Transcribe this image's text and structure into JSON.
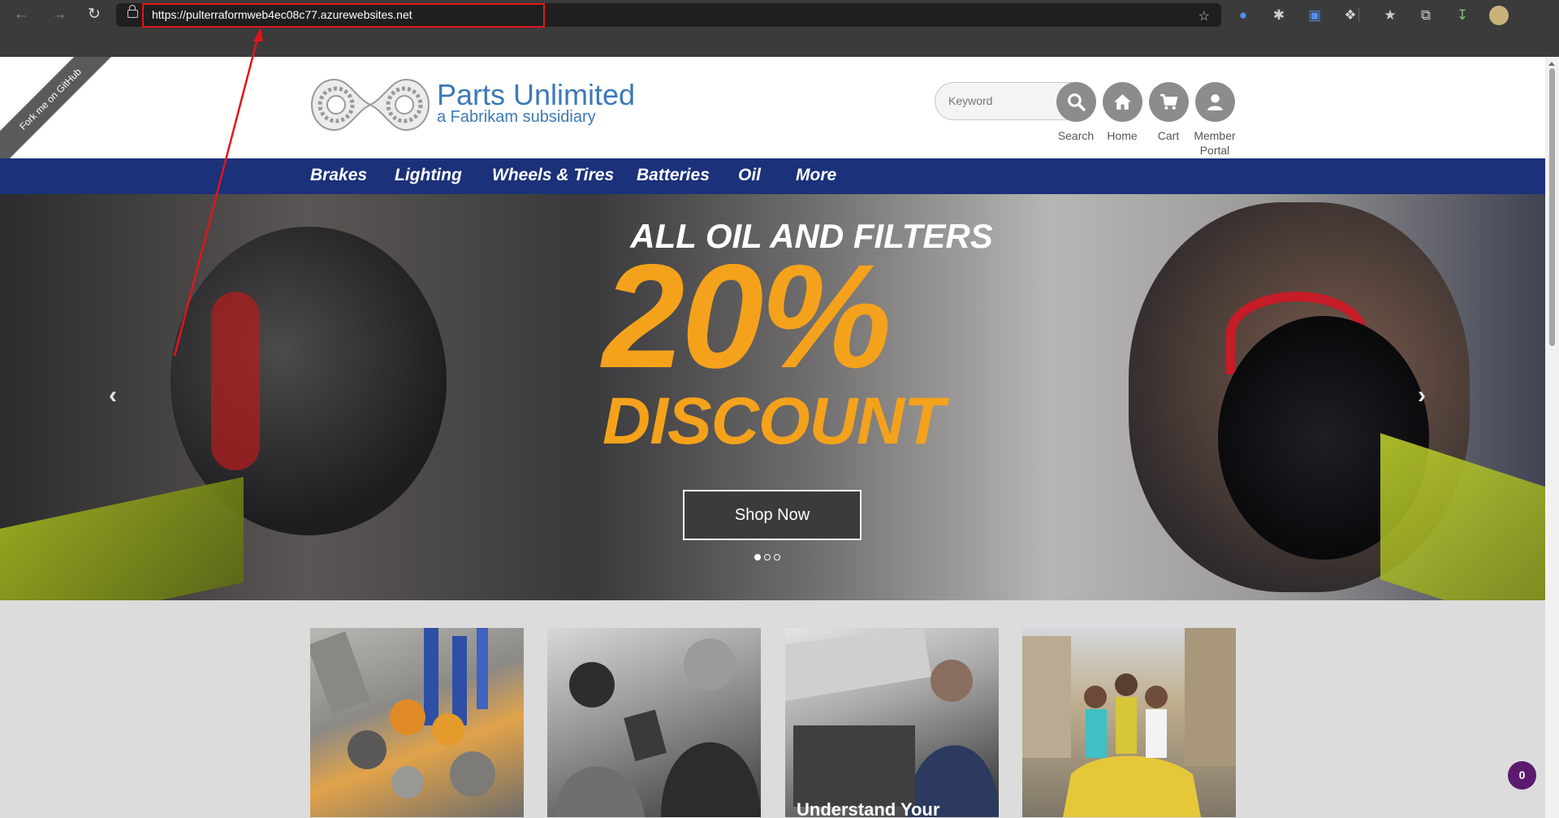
{
  "browser": {
    "url": "https://pulterraformweb4ec08c77.azurewebsites.net",
    "icons": [
      "back-icon",
      "forward-icon",
      "reload-icon",
      "lock-icon",
      "favorite-add-icon",
      "extension-icon",
      "bug-icon",
      "screenshot-icon",
      "puzzle-icon",
      "favorites-icon",
      "collections-icon",
      "downloads-icon",
      "profile-icon"
    ]
  },
  "ribbon": {
    "label": "Fork me on GitHub"
  },
  "brand": {
    "title": "Parts Unlimited",
    "subtitle": "a Fabrikam subsidiary"
  },
  "header": {
    "search_placeholder": "Keyword",
    "search_label": "Search",
    "home_label": "Home",
    "cart_label": "Cart",
    "member_label_1": "Member",
    "member_label_2": "Portal"
  },
  "menu": [
    "Brakes",
    "Lighting",
    "Wheels & Tires",
    "Batteries",
    "Oil",
    "More"
  ],
  "hero": {
    "line1": "ALL OIL AND FILTERS",
    "percent": "20%",
    "line3": "DISCOUNT",
    "button": "Shop Now",
    "slides": 3,
    "active_slide": 1
  },
  "tiles": [
    {
      "caption": ""
    },
    {
      "caption": ""
    },
    {
      "caption": "Understand Your"
    },
    {
      "caption": ""
    }
  ],
  "badge": {
    "count": "0"
  },
  "colors": {
    "menubar": "#1b3179",
    "accent": "#f4a21b",
    "brand": "#3d79b6",
    "annotation": "#e2141c"
  }
}
